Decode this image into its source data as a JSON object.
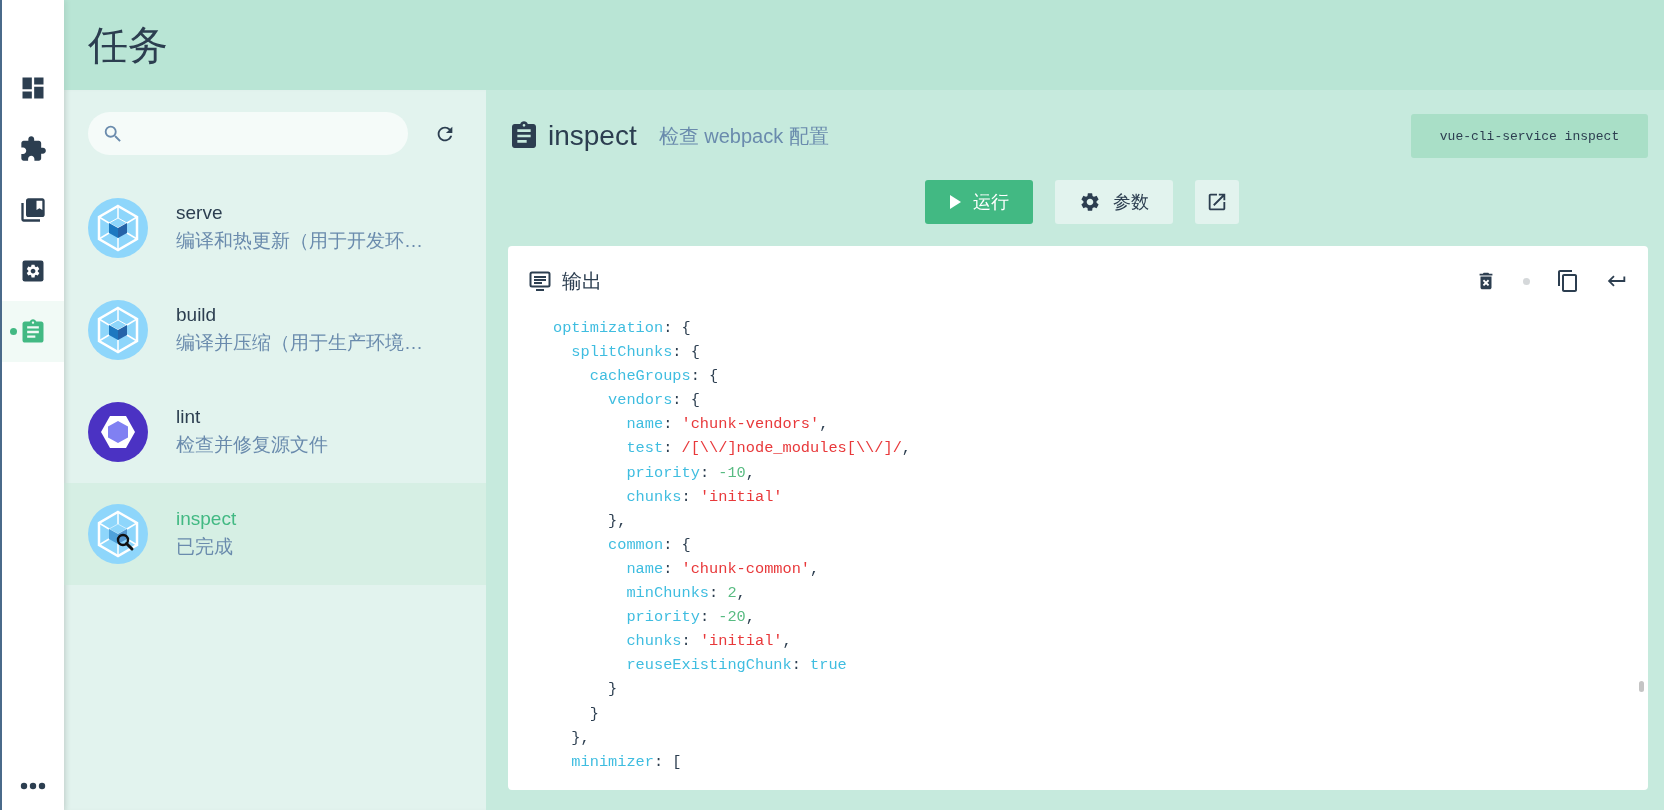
{
  "nav": {
    "items": [
      {
        "kind": "dashboard",
        "selected": false
      },
      {
        "kind": "plugins",
        "selected": false
      },
      {
        "kind": "dependencies",
        "selected": false
      },
      {
        "kind": "configuration",
        "selected": false
      },
      {
        "kind": "tasks",
        "selected": true
      }
    ]
  },
  "header": {
    "title": "任务"
  },
  "tasks": [
    {
      "kind": "webpack",
      "name": "serve",
      "description": "编译和热更新（用于开发环…",
      "selected": false
    },
    {
      "kind": "webpack",
      "name": "build",
      "description": "编译并压缩（用于生产环境…",
      "selected": false
    },
    {
      "kind": "eslint",
      "name": "lint",
      "description": "检查并修复源文件",
      "selected": false
    },
    {
      "kind": "inspect",
      "name": "inspect",
      "description": "已完成",
      "selected": true
    }
  ],
  "detail": {
    "name": "inspect",
    "description": "检查 webpack 配置",
    "command": "vue-cli-service inspect",
    "buttons": [
      {
        "kind": "run",
        "label": "运行"
      },
      {
        "kind": "params",
        "label": "参数"
      },
      {
        "kind": "open"
      }
    ]
  },
  "output": {
    "title": "输出",
    "lines": [
      [
        {
          "kind": "key",
          "text": "optimization"
        },
        {
          "kind": "punct",
          "text": ": {"
        }
      ],
      [
        {
          "kind": "key",
          "text": "  splitChunks"
        },
        {
          "kind": "punct",
          "text": ": {"
        }
      ],
      [
        {
          "kind": "key",
          "text": "    cacheGroups"
        },
        {
          "kind": "punct",
          "text": ": {"
        }
      ],
      [
        {
          "kind": "key",
          "text": "      vendors"
        },
        {
          "kind": "punct",
          "text": ": {"
        }
      ],
      [
        {
          "kind": "key",
          "text": "        name"
        },
        {
          "kind": "punct",
          "text": ": "
        },
        {
          "kind": "string",
          "text": "'chunk-vendors'"
        },
        {
          "kind": "punct",
          "text": ","
        }
      ],
      [
        {
          "kind": "key",
          "text": "        test"
        },
        {
          "kind": "punct",
          "text": ": "
        },
        {
          "kind": "string",
          "text": "/[\\\\/]node_modules[\\\\/]/"
        },
        {
          "kind": "punct",
          "text": ","
        }
      ],
      [
        {
          "kind": "key",
          "text": "        priority"
        },
        {
          "kind": "punct",
          "text": ": "
        },
        {
          "kind": "number",
          "text": "-10"
        },
        {
          "kind": "punct",
          "text": ","
        }
      ],
      [
        {
          "kind": "key",
          "text": "        chunks"
        },
        {
          "kind": "punct",
          "text": ": "
        },
        {
          "kind": "string",
          "text": "'initial'"
        }
      ],
      [
        {
          "kind": "punct",
          "text": "      },"
        }
      ],
      [
        {
          "kind": "key",
          "text": "      common"
        },
        {
          "kind": "punct",
          "text": ": {"
        }
      ],
      [
        {
          "kind": "key",
          "text": "        name"
        },
        {
          "kind": "punct",
          "text": ": "
        },
        {
          "kind": "string",
          "text": "'chunk-common'"
        },
        {
          "kind": "punct",
          "text": ","
        }
      ],
      [
        {
          "kind": "key",
          "text": "        minChunks"
        },
        {
          "kind": "punct",
          "text": ": "
        },
        {
          "kind": "number",
          "text": "2"
        },
        {
          "kind": "punct",
          "text": ","
        }
      ],
      [
        {
          "kind": "key",
          "text": "        priority"
        },
        {
          "kind": "punct",
          "text": ": "
        },
        {
          "kind": "number",
          "text": "-20"
        },
        {
          "kind": "punct",
          "text": ","
        }
      ],
      [
        {
          "kind": "key",
          "text": "        chunks"
        },
        {
          "kind": "punct",
          "text": ": "
        },
        {
          "kind": "string",
          "text": "'initial'"
        },
        {
          "kind": "punct",
          "text": ","
        }
      ],
      [
        {
          "kind": "key",
          "text": "        reuseExistingChunk"
        },
        {
          "kind": "punct",
          "text": ": "
        },
        {
          "kind": "bool",
          "text": "true"
        }
      ],
      [
        {
          "kind": "punct",
          "text": "      }"
        }
      ],
      [
        {
          "kind": "punct",
          "text": "    }"
        }
      ],
      [
        {
          "kind": "punct",
          "text": "  },"
        }
      ],
      [
        {
          "kind": "key",
          "text": "  minimizer"
        },
        {
          "kind": "punct",
          "text": ": ["
        }
      ]
    ]
  }
}
